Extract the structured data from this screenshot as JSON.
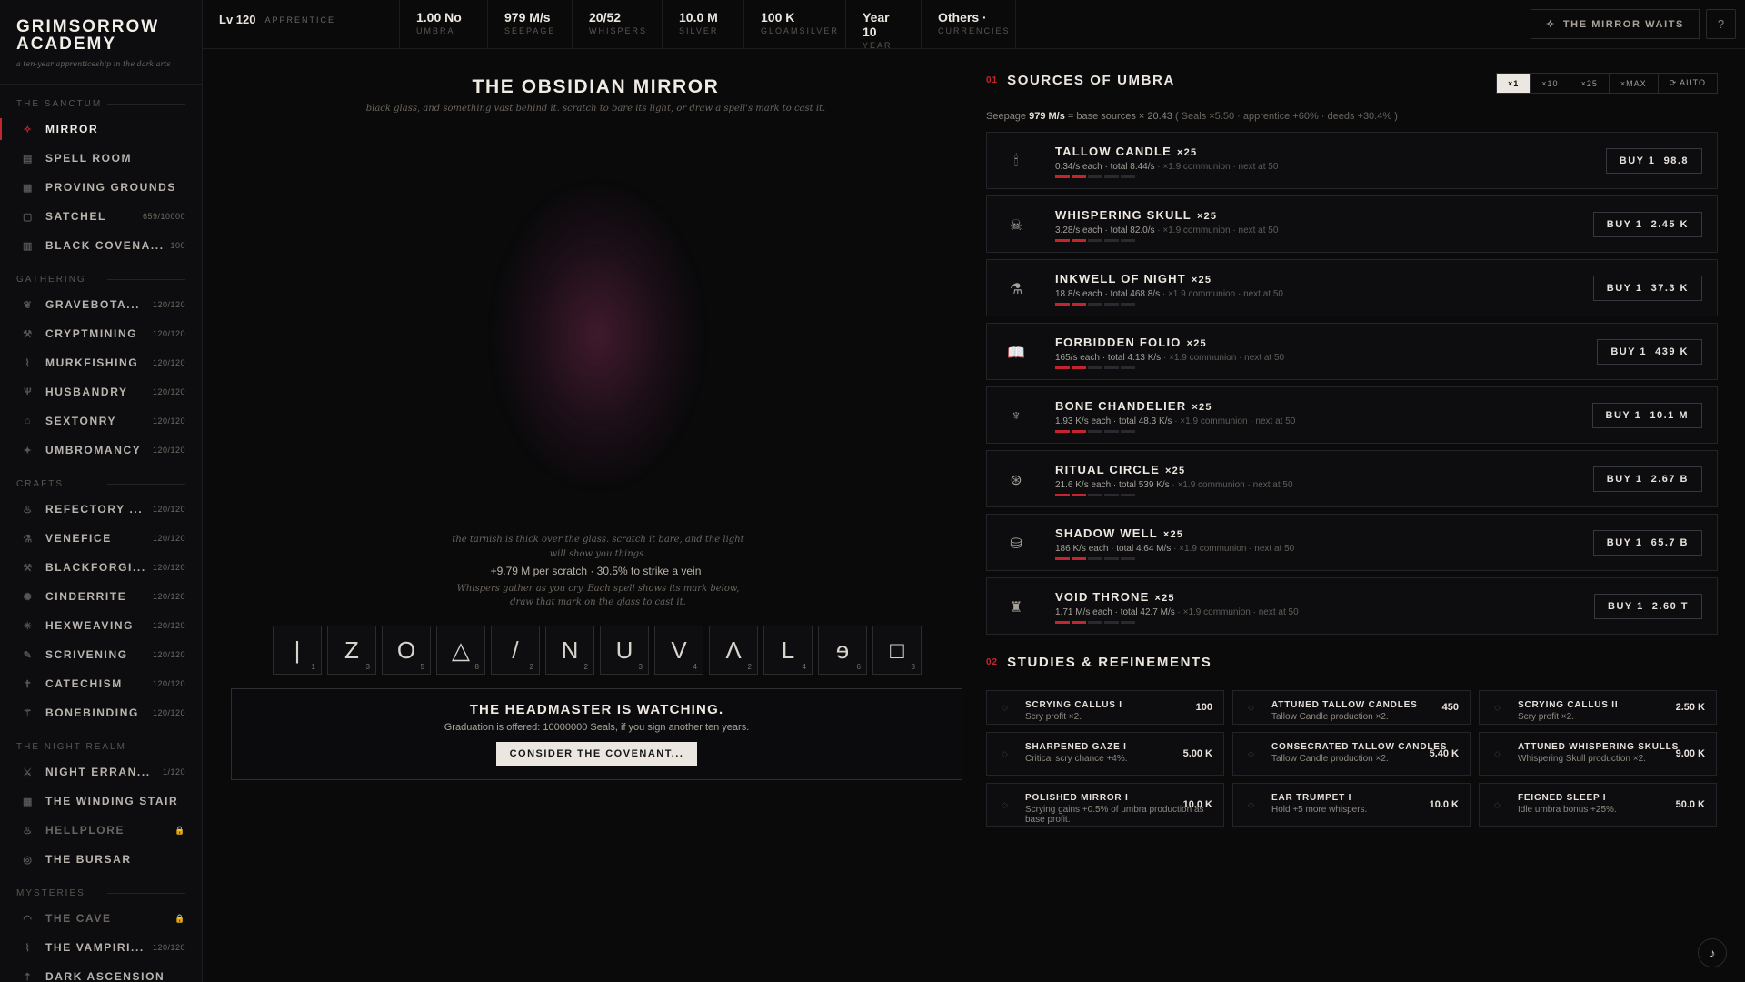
{
  "brand": {
    "title_line1": "GRIMSORROW",
    "title_line2": "ACADEMY",
    "subtitle": "a ten-year apprenticeship in the dark arts"
  },
  "sidebar": {
    "sections": [
      {
        "title": "THE SANCTUM",
        "items": [
          {
            "label": "MIRROR",
            "count": "",
            "icon": "mirror-icon",
            "active": true
          },
          {
            "label": "SPELL ROOM",
            "count": "",
            "icon": "spellroom-icon"
          },
          {
            "label": "PROVING GROUNDS",
            "count": "",
            "icon": "grounds-icon"
          },
          {
            "label": "SATCHEL",
            "count": "659/10000",
            "icon": "satchel-icon"
          },
          {
            "label": "BLACK COVENA...",
            "count": "100",
            "icon": "covenant-icon"
          }
        ]
      },
      {
        "title": "GATHERING",
        "items": [
          {
            "label": "GRAVEBOTA...",
            "count": "120/120",
            "icon": "leaf-icon"
          },
          {
            "label": "CRYPTMINING",
            "count": "120/120",
            "icon": "pick-icon"
          },
          {
            "label": "MURKFISHING",
            "count": "120/120",
            "icon": "hook-icon"
          },
          {
            "label": "HUSBANDRY",
            "count": "120/120",
            "icon": "horns-icon"
          },
          {
            "label": "SEXTONRY",
            "count": "120/120",
            "icon": "grave-icon"
          },
          {
            "label": "UMBROMANCY",
            "count": "120/120",
            "icon": "star-icon"
          }
        ]
      },
      {
        "title": "CRAFTS",
        "items": [
          {
            "label": "REFECTORY ...",
            "count": "120/120",
            "icon": "flame-icon"
          },
          {
            "label": "VENEFICE",
            "count": "120/120",
            "icon": "flask-icon"
          },
          {
            "label": "BLACKFORGI...",
            "count": "120/120",
            "icon": "hammer-icon"
          },
          {
            "label": "CINDERRITE",
            "count": "120/120",
            "icon": "ember-icon"
          },
          {
            "label": "HEXWEAVING",
            "count": "120/120",
            "icon": "web-icon"
          },
          {
            "label": "SCRIVENING",
            "count": "120/120",
            "icon": "quill-icon"
          },
          {
            "label": "CATECHISM",
            "count": "120/120",
            "icon": "cross-icon"
          },
          {
            "label": "BONEBINDING",
            "count": "120/120",
            "icon": "bone-icon"
          }
        ]
      },
      {
        "title": "THE NIGHT REALM",
        "items": [
          {
            "label": "NIGHT ERRAN...",
            "count": "1/120",
            "icon": "swords-icon"
          },
          {
            "label": "THE WINDING STAIR",
            "count": "",
            "icon": "stair-icon"
          },
          {
            "label": "HELLPLORE",
            "count": "🔒",
            "icon": "fire-icon",
            "dim": true
          },
          {
            "label": "THE BURSAR",
            "count": "",
            "icon": "coin-icon"
          }
        ]
      },
      {
        "title": "MYSTERIES",
        "items": [
          {
            "label": "THE CAVE",
            "count": "🔒",
            "icon": "cave-icon",
            "dim": true
          },
          {
            "label": "THE VAMPIRI...",
            "count": "120/120",
            "icon": "fang-icon"
          },
          {
            "label": "DARK ASCENSION",
            "count": "",
            "icon": "ascend-icon"
          }
        ]
      }
    ]
  },
  "topbar": {
    "level": "Lv 120",
    "rank": "APPRENTICE",
    "stats": [
      {
        "value": "1.00 No",
        "label": "UMBRA"
      },
      {
        "value": "979 M/s",
        "label": "SEEPAGE"
      },
      {
        "value": "20/52",
        "label": "WHISPERS"
      },
      {
        "value": "10.0 M",
        "label": "SILVER"
      },
      {
        "value": "100 K",
        "label": "GLOAMSILVER"
      },
      {
        "value": "Year 10",
        "label": "YEAR"
      },
      {
        "value": "Others ·",
        "label": "CURRENCIES"
      }
    ],
    "mirror_waits": "THE MIRROR WAITS"
  },
  "mirror": {
    "title": "THE OBSIDIAN MIRROR",
    "subtitle": "black glass, and something vast behind it. scratch to bare its light, or draw a spell's mark to cast it.",
    "hint": "the tarnish is thick over the glass. scratch it bare, and the light will show you things.",
    "scratch": "+9.79 M per scratch · 30.5% to strike a vein",
    "whispers": "Whispers gather as you cry. Each spell shows its mark below, draw that mark on the glass to cast it.",
    "runes": [
      {
        "glyph": "|",
        "n": "1"
      },
      {
        "glyph": "Z",
        "n": "3"
      },
      {
        "glyph": "O",
        "n": "5"
      },
      {
        "glyph": "△",
        "n": "8"
      },
      {
        "glyph": "/",
        "n": "2"
      },
      {
        "glyph": "N",
        "n": "2"
      },
      {
        "glyph": "U",
        "n": "3"
      },
      {
        "glyph": "V",
        "n": "4"
      },
      {
        "glyph": "Λ",
        "n": "2"
      },
      {
        "glyph": "L",
        "n": "4"
      },
      {
        "glyph": "ɘ",
        "n": "6"
      },
      {
        "glyph": "□",
        "n": "8"
      }
    ],
    "headmaster_title": "THE HEADMASTER IS WATCHING.",
    "headmaster_text": "Graduation is offered: 10000000 Seals, if you sign another ten years.",
    "covenant_button": "CONSIDER THE COVENANT..."
  },
  "sources": {
    "num": "01",
    "title": "SOURCES OF UMBRA",
    "multipliers": [
      "×1",
      "×10",
      "×25",
      "×MAX",
      "⟳ AUTO"
    ],
    "seepage_label": "Seepage",
    "seepage_value": "979 M/s",
    "seepage_formula": "= base sources × 20.43",
    "seepage_detail": "( Seals ×5.50 · apprentice +60% · deeds +30.4% )",
    "items": [
      {
        "name": "TALLOW CANDLE",
        "count": "×25",
        "each": "0.34/s each · total 8.44/s",
        "extra": "· ×1.9 communion · next at 50",
        "buy": "BUY 1  98.8",
        "icon": "candle-icon",
        "glyph": "🕯"
      },
      {
        "name": "WHISPERING SKULL",
        "count": "×25",
        "each": "3.28/s each · total 82.0/s",
        "extra": "· ×1.9 communion · next at 50",
        "buy": "BUY 1  2.45 K",
        "icon": "skull-icon",
        "glyph": "☠"
      },
      {
        "name": "INKWELL OF NIGHT",
        "count": "×25",
        "each": "18.8/s each · total 468.8/s",
        "extra": "· ×1.9 communion · next at 50",
        "buy": "BUY 1  37.3 K",
        "icon": "inkwell-icon",
        "glyph": "⚗"
      },
      {
        "name": "FORBIDDEN FOLIO",
        "count": "×25",
        "each": "165/s each · total 4.13 K/s",
        "extra": "· ×1.9 communion · next at 50",
        "buy": "BUY 1  439 K",
        "icon": "book-icon",
        "glyph": "📖"
      },
      {
        "name": "BONE CHANDELIER",
        "count": "×25",
        "each": "1.93 K/s each · total 48.3 K/s",
        "extra": "· ×1.9 communion · next at 50",
        "buy": "BUY 1  10.1 M",
        "icon": "chandelier-icon",
        "glyph": "♆"
      },
      {
        "name": "RITUAL CIRCLE",
        "count": "×25",
        "each": "21.6 K/s each · total 539 K/s",
        "extra": "· ×1.9 communion · next at 50",
        "buy": "BUY 1  2.67 B",
        "icon": "circle-icon",
        "glyph": "⊛"
      },
      {
        "name": "SHADOW WELL",
        "count": "×25",
        "each": "186 K/s each · total 4.64 M/s",
        "extra": "· ×1.9 communion · next at 50",
        "buy": "BUY 1  65.7 B",
        "icon": "well-icon",
        "glyph": "⛁"
      },
      {
        "name": "VOID THRONE",
        "count": "×25",
        "each": "1.71 M/s each · total 42.7 M/s",
        "extra": "· ×1.9 communion · next at 50",
        "buy": "BUY 1  2.60 T",
        "icon": "throne-icon",
        "glyph": "♜"
      }
    ]
  },
  "studies": {
    "num": "02",
    "title": "STUDIES & REFINEMENTS",
    "items": [
      {
        "name": "SCRYING CALLUS I",
        "desc": "Scry profit ×2.",
        "price": "100"
      },
      {
        "name": "ATTUNED TALLOW CANDLES",
        "desc": "Tallow Candle production ×2.",
        "price": "450"
      },
      {
        "name": "SCRYING CALLUS II",
        "desc": "Scry profit ×2.",
        "price": "2.50 K"
      },
      {
        "name": "SHARPENED GAZE I",
        "desc": "Critical scry chance +4%.",
        "price": "5.00 K"
      },
      {
        "name": "CONSECRATED TALLOW CANDLES",
        "desc": "Tallow Candle production ×2.",
        "price": "5.40 K"
      },
      {
        "name": "ATTUNED WHISPERING SKULLS",
        "desc": "Whispering Skull production ×2.",
        "price": "9.00 K"
      },
      {
        "name": "POLISHED MIRROR I",
        "desc": "Scrying gains +0.5% of umbra production as base profit.",
        "price": "10.0 K"
      },
      {
        "name": "EAR TRUMPET I",
        "desc": "Hold +5 more whispers.",
        "price": "10.0 K"
      },
      {
        "name": "FEIGNED SLEEP I",
        "desc": "Idle umbra bonus +25%.",
        "price": "50.0 K"
      }
    ]
  },
  "colors": {
    "accent": "#c4262e",
    "bg": "#0a0a0b",
    "panel": "#0d0d0f"
  }
}
